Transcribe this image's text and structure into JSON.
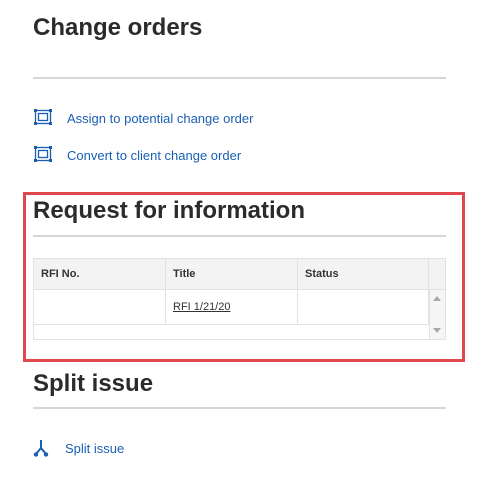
{
  "change_orders": {
    "title": "Change orders",
    "actions": [
      {
        "label": "Assign to potential change order",
        "icon": "change-order-icon"
      },
      {
        "label": "Convert to client change order",
        "icon": "change-order-icon"
      }
    ]
  },
  "rfi": {
    "title": "Request for information",
    "columns": [
      "RFI No.",
      "Title",
      "Status"
    ],
    "rows": [
      {
        "rfi_no": "",
        "title": "RFI 1/21/20",
        "status": ""
      }
    ]
  },
  "split_issue": {
    "title": "Split issue",
    "action": {
      "label": "Split issue",
      "icon": "split-icon"
    }
  },
  "colors": {
    "link": "#1a5fb4",
    "highlight": "#e0474c",
    "divider": "#d6d6d6",
    "table_header": "#f3f3f3"
  }
}
